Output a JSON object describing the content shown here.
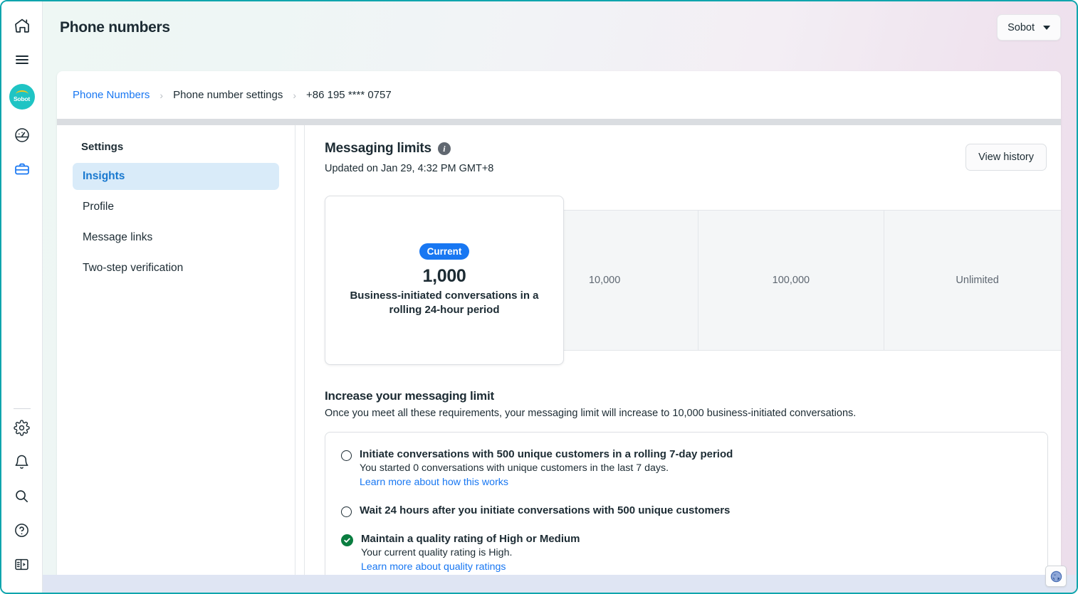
{
  "rail": {
    "icons": [
      {
        "name": "home-icon",
        "label": "Home"
      },
      {
        "name": "menu-icon",
        "label": "Menu"
      }
    ],
    "avatar_label": "Sobot",
    "mid_icons": [
      {
        "name": "dashboard-icon",
        "label": "Dashboard"
      },
      {
        "name": "briefcase-icon",
        "label": "Business"
      }
    ],
    "bottom_icons": [
      {
        "name": "gear-icon",
        "label": "Settings"
      },
      {
        "name": "bell-icon",
        "label": "Notifications"
      },
      {
        "name": "search-icon",
        "label": "Search"
      },
      {
        "name": "help-icon",
        "label": "Help"
      },
      {
        "name": "panel-toggle-icon",
        "label": "Toggle panel"
      }
    ]
  },
  "topbar": {
    "title": "Phone numbers",
    "account_label": "Sobot",
    "caret_icon": "chevron-down-icon"
  },
  "breadcrumb": {
    "items": [
      {
        "label": "Phone Numbers",
        "link": true
      },
      {
        "label": "Phone number settings",
        "link": false
      },
      {
        "label": "+86 195 **** 0757",
        "link": false
      }
    ],
    "separator": "›"
  },
  "settings": {
    "heading": "Settings",
    "items": [
      {
        "label": "Insights",
        "active": true
      },
      {
        "label": "Profile",
        "active": false
      },
      {
        "label": "Message links",
        "active": false
      },
      {
        "label": "Two-step verification",
        "active": false
      }
    ]
  },
  "messaging": {
    "title": "Messaging limits",
    "info_icon": "info-icon",
    "updated": "Updated on Jan 29, 4:32 PM GMT+8",
    "history_button": "View history"
  },
  "tiers": {
    "current": {
      "badge": "Current",
      "value": "1,000",
      "description": "Business-initiated conversations in a rolling 24-hour period"
    },
    "others": [
      {
        "value": "10,000"
      },
      {
        "value": "100,000"
      },
      {
        "value": "Unlimited"
      }
    ]
  },
  "increase": {
    "title": "Increase your messaging limit",
    "subtitle": "Once you meet all these requirements, your messaging limit will increase to 10,000 business-initiated conversations.",
    "requirements": [
      {
        "state": "incomplete",
        "icon": "radio-unchecked-icon",
        "title": "Initiate conversations with 500 unique customers in a rolling 7-day period",
        "description": "You started 0 conversations with unique customers in the last 7 days.",
        "link": "Learn more about how this works"
      },
      {
        "state": "incomplete",
        "icon": "radio-unchecked-icon",
        "title": "Wait 24 hours after you initiate conversations with 500 unique customers",
        "description": "",
        "link": ""
      },
      {
        "state": "complete",
        "icon": "check-circle-icon",
        "title": "Maintain a quality rating of High or Medium",
        "description": "Your current quality rating is High.",
        "link": "Learn more about quality ratings"
      }
    ]
  },
  "footer": {
    "globe_icon": "globe-icon"
  },
  "colors": {
    "accent_blue": "#1877f2",
    "active_nav_bg": "#d9ebf9",
    "active_nav_text": "#1878cf",
    "success_green": "#0a7d40",
    "brand_teal": "#1fc4c4",
    "text_primary": "#1c2b33",
    "text_muted": "#5e6771"
  }
}
